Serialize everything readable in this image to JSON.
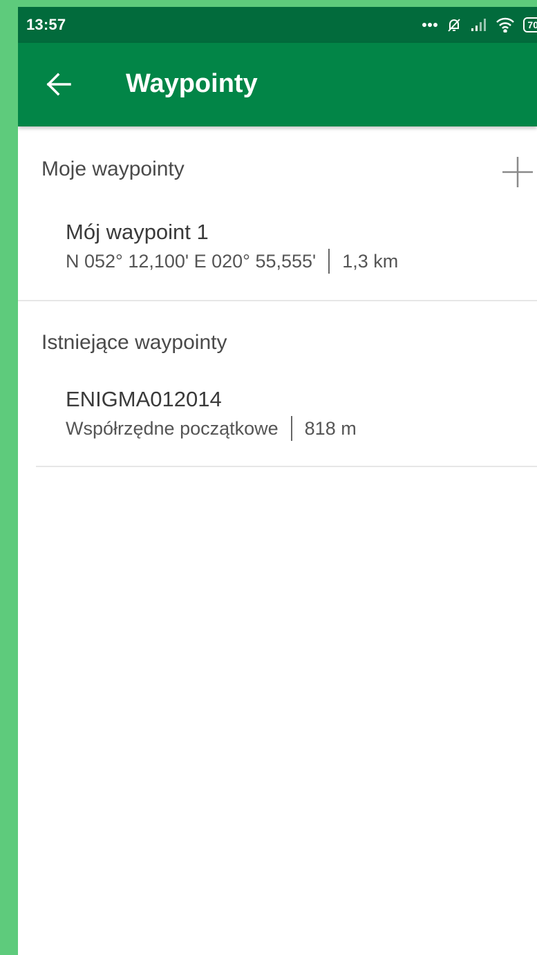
{
  "status_bar": {
    "time": "13:57",
    "battery": "70",
    "icons": [
      "more-dots-icon",
      "notifications-off-icon",
      "signal-icon",
      "wifi-icon",
      "battery-icon"
    ]
  },
  "app_bar": {
    "title": "Waypointy",
    "back_icon": "arrow-back-icon",
    "color": "#028547"
  },
  "sections": {
    "my": {
      "header": "Moje waypointy",
      "add_icon": "plus-icon",
      "items": [
        {
          "name": "Mój waypoint 1",
          "coords": "N 052° 12,100' E 020° 55,555'",
          "distance": "1,3 km"
        }
      ]
    },
    "existing": {
      "header": "Istniejące waypointy",
      "items": [
        {
          "name": "ENIGMA012014",
          "desc": "Współrzędne początkowe",
          "distance": "818 m"
        }
      ]
    }
  },
  "colors": {
    "status_bar": "#026b3c",
    "app_bar": "#028547",
    "frame": "#5ecb7c"
  }
}
